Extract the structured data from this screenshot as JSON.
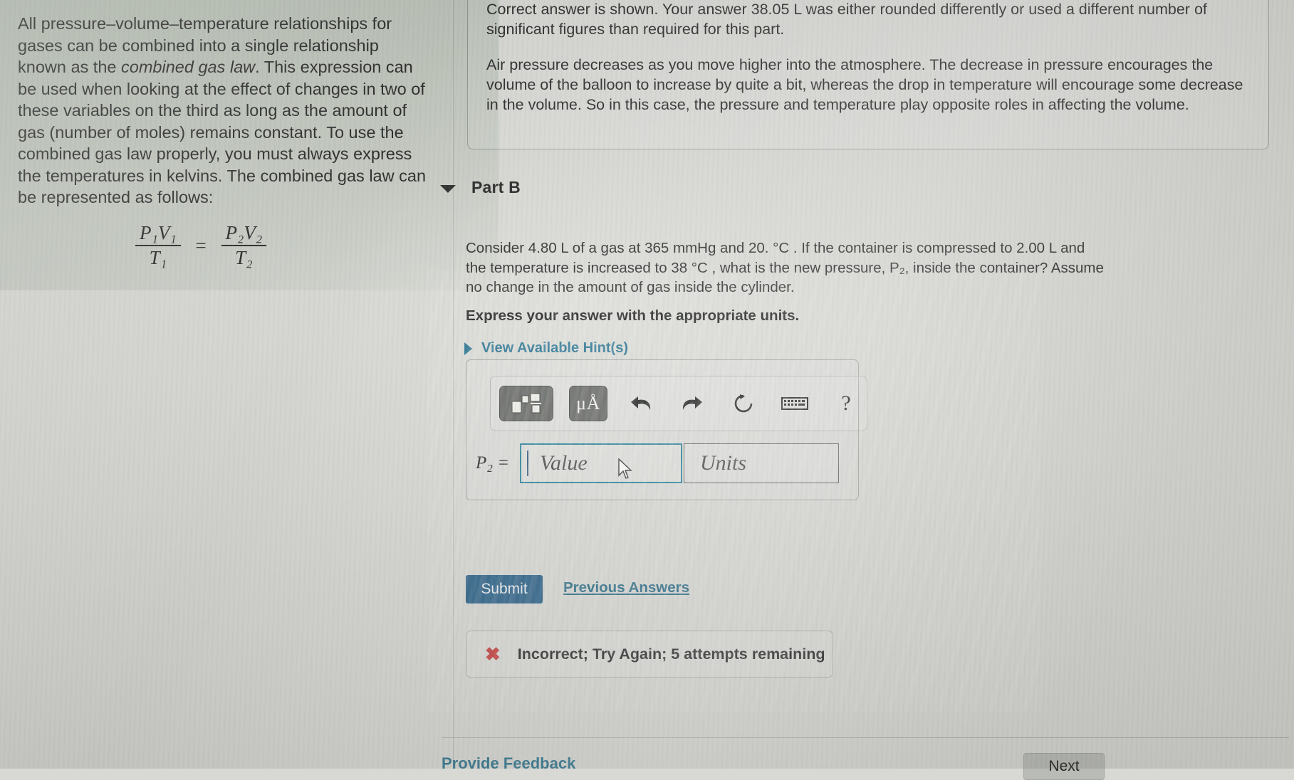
{
  "left_panel": {
    "paragraph_part1": "All pressure–volume–temperature relationships for gases can be combined into a single relationship known as the ",
    "italic_term": "combined gas law",
    "paragraph_part2": ". This expression can be used when looking at the effect of changes in two of these variables on the third as long as the amount of gas (number of moles) remains constant. To use the combined gas law properly, you must always express the temperatures in kelvins. The combined gas law can be represented as follows:",
    "formula": {
      "left_numerator": "P₁V₁",
      "left_denominator": "T₁",
      "equals": "=",
      "right_numerator": "P₂V₂",
      "right_denominator": "T₂"
    }
  },
  "correct_answer_box": {
    "line1": "Correct answer is shown. Your answer 38.05 L was either rounded differently or used a different number of significant figures than required for this part.",
    "line2": "Air pressure decreases as you move higher into the atmosphere. The decrease in pressure encourages the volume of the balloon to increase by quite a bit, whereas the drop in temperature will encourage some decrease in the volume. So in this case, the pressure and temperature play opposite roles in affecting the volume."
  },
  "part_b": {
    "caret_icon": "triangle-down-icon",
    "title": "Part B",
    "question": "Consider 4.80 L of a gas at 365 mmHg and 20. °C . If the container is compressed to 2.00 L and the temperature is increased to 38 °C , what is the new pressure, P₂, inside the container? Assume no change in the amount of gas inside the cylinder.",
    "instruction": "Express your answer with the appropriate units.",
    "hint_link": "View Available Hint(s)",
    "hint_caret_icon": "triangle-right-icon"
  },
  "answer_widget": {
    "toolbar": [
      {
        "name": "template-math-icon",
        "label": "▣"
      },
      {
        "name": "units-micro-angstrom-icon",
        "label": "μÅ"
      },
      {
        "name": "undo-icon",
        "label": "↶"
      },
      {
        "name": "redo-icon",
        "label": "↷"
      },
      {
        "name": "reset-icon",
        "label": "↻"
      },
      {
        "name": "keyboard-icon",
        "label": "⌨"
      },
      {
        "name": "help-icon",
        "label": "?"
      }
    ],
    "variable_label": "P₂ =",
    "value_placeholder": "Value",
    "units_placeholder": "Units"
  },
  "actions": {
    "submit_label": "Submit",
    "previous_answers_label": "Previous Answers",
    "next_label": "Next",
    "provide_feedback_label": "Provide Feedback"
  },
  "feedback": {
    "icon": "x-mark-icon",
    "icon_glyph": "✖",
    "message": "Incorrect; Try Again; 5 attempts remaining"
  },
  "colors": {
    "accent_link": "#1f6c8c",
    "submit_bg": "#1b5580",
    "error_red": "#c32a2a",
    "field_focus_border": "#1a7a94",
    "page_bg": "#d8d9d4",
    "left_panel_tint": "#bfc8bd"
  }
}
